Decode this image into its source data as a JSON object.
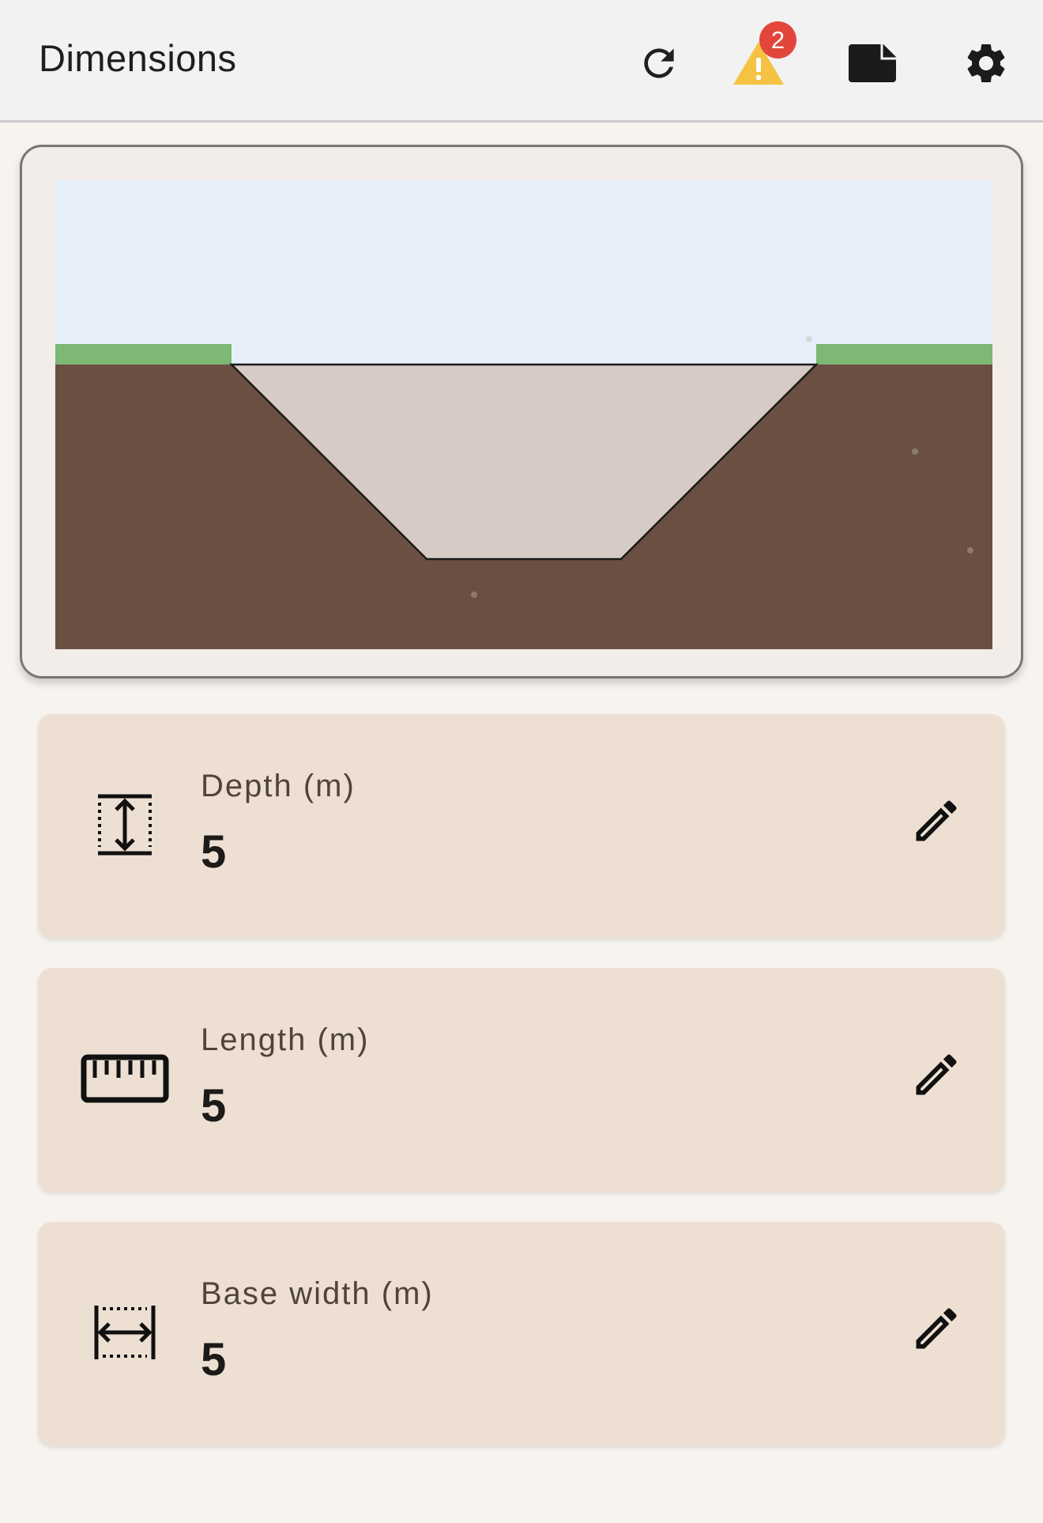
{
  "app_bar": {
    "title": "Dimensions",
    "actions": [
      {
        "icon": "refresh-icon"
      },
      {
        "icon": "warning-icon",
        "badge_count": "2"
      },
      {
        "icon": "note-icon"
      },
      {
        "icon": "settings-icon"
      }
    ]
  },
  "preview": {
    "colors": {
      "sky": "#e6effa",
      "grass": "#7db874",
      "soil": "#6b4f42",
      "trench": "#d7cbc6",
      "outline": "#1c1b1a"
    },
    "trench": {
      "depth": 5,
      "base_width": 5
    }
  },
  "fields": [
    {
      "icon": "depth-icon",
      "label": "Depth (m)",
      "value": "5"
    },
    {
      "icon": "ruler-icon",
      "label": "Length (m)",
      "value": "5"
    },
    {
      "icon": "width-icon",
      "label": "Base width (m)",
      "value": "5"
    }
  ]
}
